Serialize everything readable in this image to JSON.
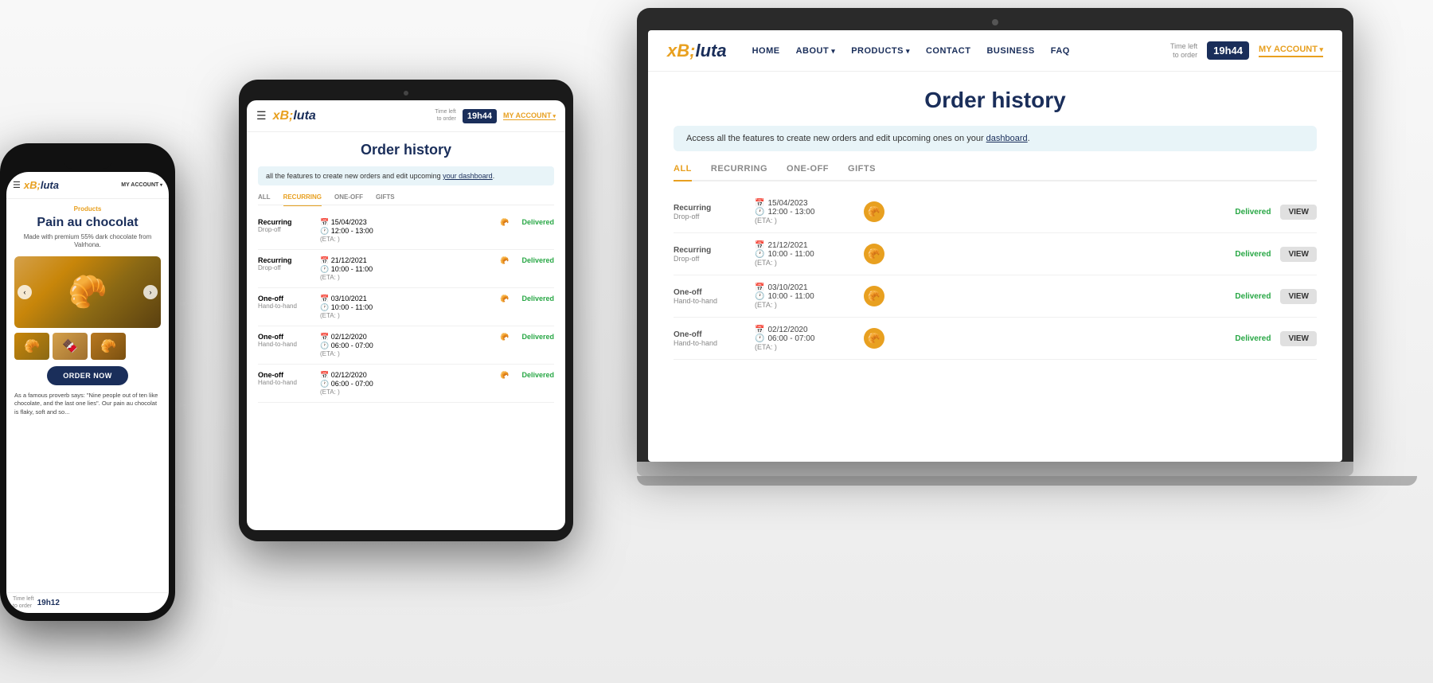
{
  "brand": {
    "name": "Bluta",
    "logo_b": "B",
    "logo_rest": "luta"
  },
  "laptop": {
    "nav": {
      "links": [
        {
          "label": "HOME",
          "has_arrow": false
        },
        {
          "label": "ABOUT",
          "has_arrow": true
        },
        {
          "label": "PRODUCTS",
          "has_arrow": true
        },
        {
          "label": "CONTACT",
          "has_arrow": false
        },
        {
          "label": "BUSINESS",
          "has_arrow": false
        },
        {
          "label": "FAQ",
          "has_arrow": false
        }
      ],
      "time_left_label": "Time left\nto order",
      "time_value": "19h44",
      "my_account": "MY ACCOUNT"
    },
    "content": {
      "title": "Order history",
      "info_banner": "Access all the features to create new orders and edit upcoming ones on your",
      "info_link": "dashboard",
      "info_suffix": ".",
      "tabs": [
        "ALL",
        "RECURRING",
        "ONE-OFF",
        "GIFTS"
      ],
      "active_tab": "ALL",
      "orders": [
        {
          "type": "Recurring",
          "sub": "Drop-off",
          "date": "15/04/2023",
          "time": "12:00 - 13:00",
          "eta": "(ETA: )",
          "item_count": "1",
          "status": "Delivered"
        },
        {
          "type": "Recurring",
          "sub": "Drop-off",
          "date": "21/12/2021",
          "time": "10:00 - 11:00",
          "eta": "(ETA: )",
          "item_count": "1",
          "status": "Delivered"
        },
        {
          "type": "One-off",
          "sub": "Hand-to-hand",
          "date": "03/10/2021",
          "time": "10:00 - 11:00",
          "eta": "(ETA: )",
          "item_count": "1",
          "status": "Delivered"
        },
        {
          "type": "One-off",
          "sub": "Hand-to-hand",
          "date": "02/12/2020",
          "time": "06:00 - 07:00",
          "eta": "(ETA: )",
          "item_count": "1",
          "status": "Delivered"
        }
      ]
    }
  },
  "tablet": {
    "nav": {
      "time_value": "19h44",
      "time_label": "Time left\nto order",
      "my_account": "MY ACCOUNT"
    },
    "content": {
      "title": "Order history",
      "info_text": "all the features to create new orders and edit upcoming",
      "info_link": "your dashboard",
      "tabs": [
        "ALL",
        "RECURRING",
        "ONE-OFF",
        "GIFTS"
      ],
      "active_tab": "ALL",
      "orders": [
        {
          "date": "15/04/2023",
          "time": "12:00 - 13:00",
          "eta": "(ETA: )",
          "status": "Delivered"
        },
        {
          "date": "21/12/2021",
          "time": "10:00 - 11:00",
          "eta": "(ETA: )",
          "status": "Delivered"
        },
        {
          "date": "03/10/2021",
          "time": "10:00 - 11:00",
          "eta": "(ETA: )",
          "status": "Delivered"
        },
        {
          "date": "02/12/2020",
          "time": "06:00 - 07:00",
          "eta": "(ETA: )",
          "status": "Delivered"
        },
        {
          "date": "02/12/2020",
          "time": "06:00 - 07:00",
          "eta": "(ETA: )",
          "status": "Delivered"
        }
      ]
    }
  },
  "phone": {
    "nav": {
      "my_account": "MY ACCOUNT"
    },
    "content": {
      "category": "Products",
      "product_name": "Pain au chocolat",
      "product_desc": "Made with premium 55% dark chocolate from Valrhona.",
      "order_button": "ORDER NOW",
      "description": "As a famous proverb says: \"Nine people out of ten like chocolate, and the last one lies\". Our pain au chocolat is flaky, soft and so..."
    },
    "bottom": {
      "time_label": "Time left\nto order",
      "time_value": "19h12"
    }
  }
}
